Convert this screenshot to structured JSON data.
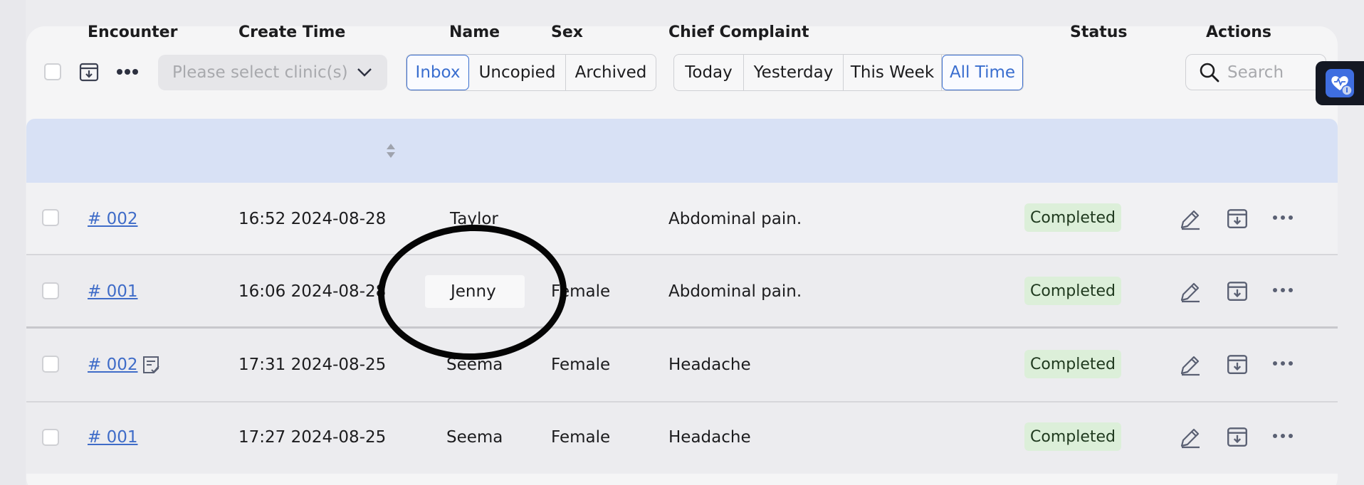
{
  "toolbar": {
    "clinic_placeholder": "Please select clinic(s)",
    "folders": [
      {
        "label": "Inbox",
        "active": true
      },
      {
        "label": "Uncopied",
        "active": false
      },
      {
        "label": "Archived",
        "active": false
      }
    ],
    "time_filters": [
      {
        "label": "Today",
        "active": false
      },
      {
        "label": "Yesterday",
        "active": false
      },
      {
        "label": "This Week",
        "active": false
      },
      {
        "label": "All Time",
        "active": true
      }
    ],
    "search_placeholder": "Search"
  },
  "table": {
    "headers": {
      "encounter": "Encounter",
      "create_time": "Create Time",
      "name": "Name",
      "sex": "Sex",
      "chief_complaint": "Chief Complaint",
      "status": "Status",
      "actions": "Actions"
    },
    "rows": [
      {
        "encounter": "# 002",
        "create_time": "16:52 2024-08-28",
        "name": "Taylor",
        "sex": "",
        "chief_complaint": "Abdominal pain.",
        "status": "Completed",
        "has_note_icon": false
      },
      {
        "encounter": "# 001",
        "create_time": "16:06 2024-08-28",
        "name": "Jenny",
        "sex": "Female",
        "chief_complaint": "Abdominal pain.",
        "status": "Completed",
        "has_note_icon": false
      },
      {
        "encounter": "# 002",
        "create_time": "17:31 2024-08-25",
        "name": "Seema",
        "sex": "Female",
        "chief_complaint": "Headache",
        "status": "Completed",
        "has_note_icon": true
      },
      {
        "encounter": "# 001",
        "create_time": "17:27 2024-08-25",
        "name": "Seema",
        "sex": "Female",
        "chief_complaint": "Headache",
        "status": "Completed",
        "has_note_icon": false
      }
    ]
  },
  "colors": {
    "accent": "#3a6ecf",
    "header_bg": "#d8e1f5",
    "status_bg": "#dcefd9",
    "annotation": "#050505"
  },
  "icons": [
    "archive-download-icon",
    "more-dots-icon",
    "chevron-down-icon",
    "search-icon",
    "heart-extension-icon",
    "sort-arrows-icon",
    "note-check-icon",
    "edit-pencil-icon",
    "more-horizontal-icon"
  ]
}
